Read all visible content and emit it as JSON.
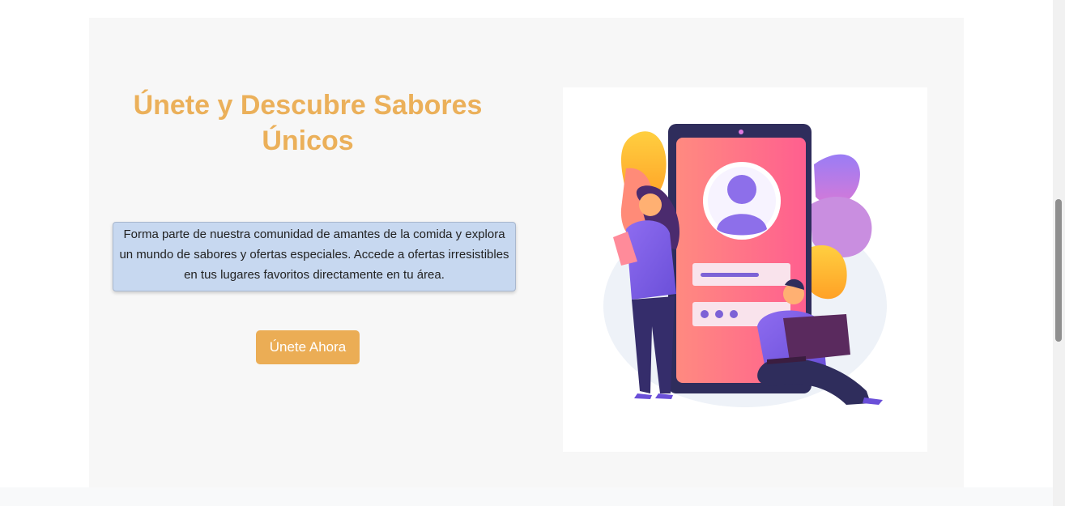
{
  "hero": {
    "title": "Únete y Descubre Sabores Únicos",
    "description": "Forma parte de nuestra comunidad de amantes de la comida y explora un mundo de sabores y ofertas especiales. Accede a ofertas irresistibles en tus lugares favoritos directamente en tu área.",
    "cta_label": "Únete Ahora",
    "illustration_icon": "mobile-signup-illustration"
  },
  "colors": {
    "title": "#ebb05a",
    "button": "#ebad55",
    "description_bg": "#c7d8f0",
    "card_bg": "#f7f7f7"
  },
  "scrollbar": {
    "thumb_position": 0.4
  }
}
